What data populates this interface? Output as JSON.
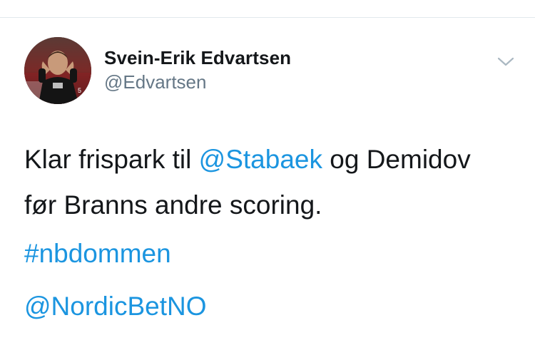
{
  "author": {
    "name": "Svein-Erik Edvartsen",
    "handle": "@Edvartsen"
  },
  "tweet": {
    "line1": {
      "prefix": "Klar frispark til ",
      "mention": "@Stabaek",
      "suffix": " og Demidov"
    },
    "line2": "før Branns andre scoring.",
    "hashtag": "#nbdommen",
    "mention2": "@NordicBetNO"
  },
  "icons": {
    "menu": "chevron-down-icon"
  },
  "colors": {
    "link": "#1b95e0",
    "text": "#14171a",
    "secondary": "#657786",
    "divider": "#e1e8ed"
  }
}
